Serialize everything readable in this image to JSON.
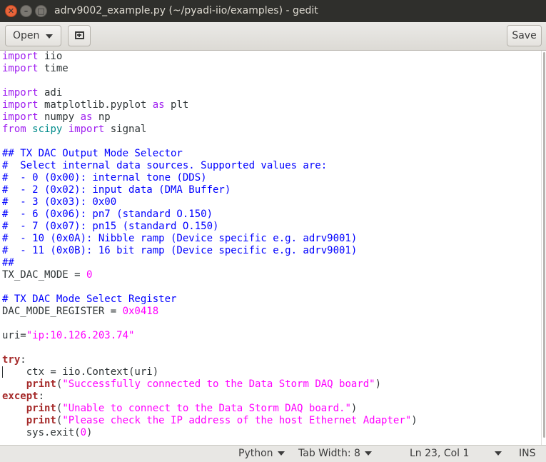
{
  "window": {
    "title": "adrv9002_example.py (~/pyadi-iio/examples) - gedit",
    "close_glyph": "✕",
    "minimize_glyph": "–",
    "maximize_glyph": "□"
  },
  "toolbar": {
    "open_label": "Open",
    "save_label": "Save",
    "new_document_icon": "new-document-icon"
  },
  "editor": {
    "cursor_line": 23,
    "lines": [
      [
        {
          "t": "kw",
          "v": "import"
        },
        {
          "t": "",
          "v": " iio"
        }
      ],
      [
        {
          "t": "kw",
          "v": "import"
        },
        {
          "t": "",
          "v": " time"
        }
      ],
      [],
      [
        {
          "t": "kw",
          "v": "import"
        },
        {
          "t": "",
          "v": " adi"
        }
      ],
      [
        {
          "t": "kw",
          "v": "import"
        },
        {
          "t": "",
          "v": " matplotlib.pyplot "
        },
        {
          "t": "kw",
          "v": "as"
        },
        {
          "t": "",
          "v": " plt"
        }
      ],
      [
        {
          "t": "kw",
          "v": "import"
        },
        {
          "t": "",
          "v": " numpy "
        },
        {
          "t": "kw",
          "v": "as"
        },
        {
          "t": "",
          "v": " np"
        }
      ],
      [
        {
          "t": "kw",
          "v": "from"
        },
        {
          "t": "",
          "v": " "
        },
        {
          "t": "mod",
          "v": "scipy"
        },
        {
          "t": "",
          "v": " "
        },
        {
          "t": "kw",
          "v": "import"
        },
        {
          "t": "",
          "v": " signal"
        }
      ],
      [],
      [
        {
          "t": "cm",
          "v": "## TX DAC Output Mode Selector"
        }
      ],
      [
        {
          "t": "cm",
          "v": "#  Select internal data sources. Supported values are:"
        }
      ],
      [
        {
          "t": "cm",
          "v": "#  - 0 (0x00): internal tone (DDS)"
        }
      ],
      [
        {
          "t": "cm",
          "v": "#  - 2 (0x02): input data (DMA Buffer)"
        }
      ],
      [
        {
          "t": "cm",
          "v": "#  - 3 (0x03): 0x00"
        }
      ],
      [
        {
          "t": "cm",
          "v": "#  - 6 (0x06): pn7 (standard O.150)"
        }
      ],
      [
        {
          "t": "cm",
          "v": "#  - 7 (0x07): pn15 (standard O.150)"
        }
      ],
      [
        {
          "t": "cm",
          "v": "#  - 10 (0x0A): Nibble ramp (Device specific e.g. adrv9001)"
        }
      ],
      [
        {
          "t": "cm",
          "v": "#  - 11 (0x0B): 16 bit ramp (Device specific e.g. adrv9001)"
        }
      ],
      [
        {
          "t": "cm",
          "v": "##"
        }
      ],
      [
        {
          "t": "",
          "v": "TX_DAC_MODE = "
        },
        {
          "t": "num",
          "v": "0"
        }
      ],
      [],
      [
        {
          "t": "cm",
          "v": "# TX DAC Mode Select Register"
        }
      ],
      [
        {
          "t": "",
          "v": "DAC_MODE_REGISTER = "
        },
        {
          "t": "num",
          "v": "0x0418"
        }
      ],
      [],
      [
        {
          "t": "",
          "v": "uri="
        },
        {
          "t": "str",
          "v": "\"ip:10.126.203.74\""
        }
      ],
      [],
      [
        {
          "t": "kwb",
          "v": "try"
        },
        {
          "t": "",
          "v": ":"
        }
      ],
      [
        {
          "t": "",
          "v": "    ctx = iio.Context(uri)"
        }
      ],
      [
        {
          "t": "",
          "v": "    "
        },
        {
          "t": "kwb",
          "v": "print"
        },
        {
          "t": "",
          "v": "("
        },
        {
          "t": "str",
          "v": "\"Successfully connected to the Data Storm DAQ board\""
        },
        {
          "t": "",
          "v": ")"
        }
      ],
      [
        {
          "t": "kwb",
          "v": "except"
        },
        {
          "t": "",
          "v": ":"
        }
      ],
      [
        {
          "t": "",
          "v": "    "
        },
        {
          "t": "kwb",
          "v": "print"
        },
        {
          "t": "",
          "v": "("
        },
        {
          "t": "str",
          "v": "\"Unable to connect to the Data Storm DAQ board.\""
        },
        {
          "t": "",
          "v": ")"
        }
      ],
      [
        {
          "t": "",
          "v": "    "
        },
        {
          "t": "kwb",
          "v": "print"
        },
        {
          "t": "",
          "v": "("
        },
        {
          "t": "str",
          "v": "\"Please check the IP address of the host Ethernet Adapter\""
        },
        {
          "t": "",
          "v": ")"
        }
      ],
      [
        {
          "t": "",
          "v": "    sys.exit("
        },
        {
          "t": "num",
          "v": "0"
        },
        {
          "t": "",
          "v": ")"
        }
      ]
    ]
  },
  "statusbar": {
    "language": "Python",
    "tab_width": "Tab Width: 8",
    "position": "Ln 23, Col 1",
    "mode": "INS"
  },
  "colors": {
    "keyword": "#a020f0",
    "statement": "#a52a2a",
    "comment": "#0000ff",
    "string": "#ff00ff",
    "module": "#008b8b",
    "close_button": "#e8643a"
  }
}
